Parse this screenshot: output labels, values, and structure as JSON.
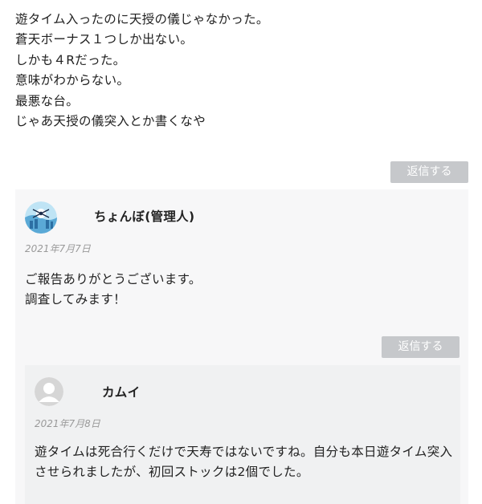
{
  "top_comment": {
    "lines": [
      "遊タイム入ったのに天授の儀じゃなかった。",
      "蒼天ボーナス１つしか出ない。",
      "しかも４Rだった。",
      "意味がわからない。",
      "最悪な台。",
      "じゃあ天授の儀突入とか書くなや"
    ]
  },
  "reply_button_label": "返信する",
  "comments": [
    {
      "author": "ちょんぼ(管理人)",
      "date": "2021年7月7日",
      "lines": [
        "ご報告ありがとうございます。",
        "調査してみます！"
      ]
    },
    {
      "author": "カムイ",
      "date": "2021年7月8日",
      "text": "遊タイムは死合行くだけで天寿ではないですね。自分も本日遊タイム突入させられましたが、初回ストックは2個でした。"
    }
  ],
  "colors": {
    "button_bg": "#c6c8cb",
    "card_bg": "#f7f7f8",
    "nested_card_bg": "#f0f1f2",
    "date_text": "#9a9a9a"
  },
  "icons": {
    "admin_avatar": "admin-avatar-icon",
    "default_avatar": "default-avatar-icon"
  }
}
